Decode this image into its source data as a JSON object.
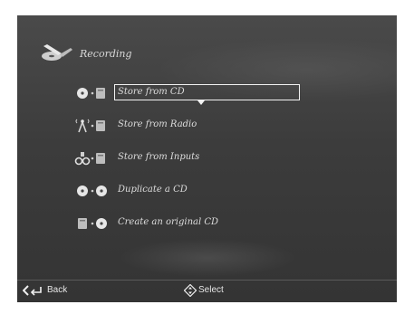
{
  "header": {
    "icon": "recording-icon",
    "title": "Recording"
  },
  "menu": {
    "selected_index": 0,
    "items": [
      {
        "label": "Store from CD",
        "icon": "cd-to-storage-icon"
      },
      {
        "label": "Store from Radio",
        "icon": "radio-to-storage-icon"
      },
      {
        "label": "Store from Inputs",
        "icon": "inputs-to-storage-icon"
      },
      {
        "label": "Duplicate a CD",
        "icon": "cd-to-cd-icon"
      },
      {
        "label": "Create an original CD",
        "icon": "storage-to-cd-icon"
      }
    ]
  },
  "footer": {
    "back_label": "Back",
    "back_icon": "back-arrow-icon",
    "select_label": "Select",
    "select_icon": "navigation-pad-icon"
  },
  "colors": {
    "background": "#3c3c3c",
    "text": "#dddddd",
    "highlight": "#f2f2f2"
  }
}
